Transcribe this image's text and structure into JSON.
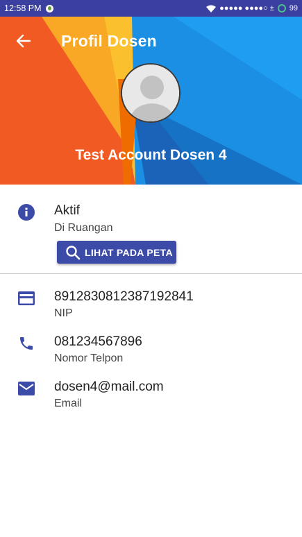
{
  "status_bar": {
    "time": "12:58 PM",
    "signal_text": "●●●●● ●●●●○ ±",
    "battery": "99"
  },
  "header": {
    "title": "Profil Dosen",
    "back_icon": "arrow-back-icon",
    "name": "Test Account Dosen 4"
  },
  "status": {
    "icon": "info-icon",
    "value": "Aktif",
    "location": "Di Ruangan",
    "map_button_label": "LIHAT PADA PETA"
  },
  "details": [
    {
      "icon": "card-icon",
      "value": "8912830812387192841",
      "label": "NIP"
    },
    {
      "icon": "phone-icon",
      "value": "081234567896",
      "label": "Nomor Telpon"
    },
    {
      "icon": "mail-icon",
      "value": "dosen4@mail.com",
      "label": "Email"
    }
  ],
  "colors": {
    "primary": "#3c4aa8",
    "status_bar": "#3a3fa0",
    "hero_blue": "#1b8fe3",
    "hero_orange": "#f15a22",
    "hero_yellow": "#f9a825"
  }
}
